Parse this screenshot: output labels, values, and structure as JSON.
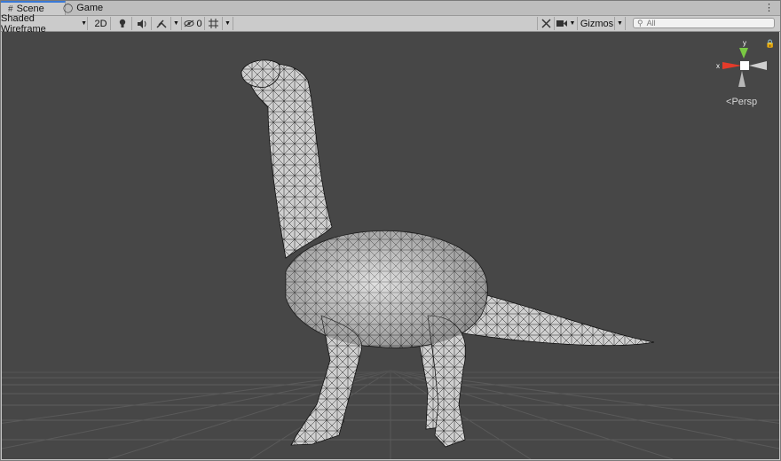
{
  "tabs": [
    {
      "label": "Scene",
      "icon": "grid-icon",
      "active": true
    },
    {
      "label": "Game",
      "icon": "gamepad-icon",
      "active": false
    }
  ],
  "toolbar": {
    "shading_mode": "Shaded Wireframe",
    "mode_2d": "2D",
    "fx_count": "0",
    "gizmos_label": "Gizmos",
    "search_placeholder": "All"
  },
  "gizmo": {
    "x_label": "x",
    "y_label": "y",
    "projection": "Persp",
    "colors": {
      "x": "#e53b2a",
      "y": "#7ac943",
      "z": "#c8c8c8"
    }
  },
  "viewport": {
    "background": "#474747",
    "grid_color": "#5d5d5d",
    "object": "brachiosaurus-mesh"
  }
}
